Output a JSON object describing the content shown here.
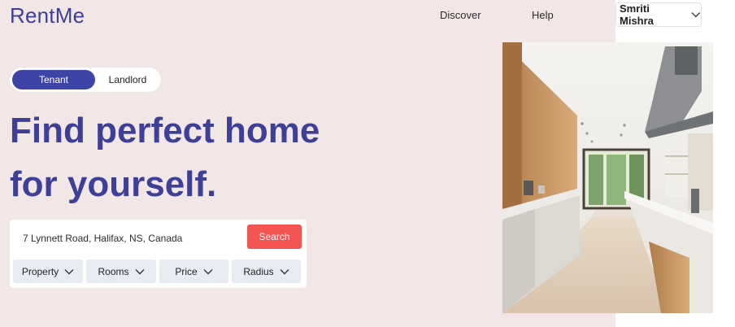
{
  "app": {
    "logo": "RentMe"
  },
  "nav": {
    "discover": "Discover",
    "help": "Help",
    "user_name": "Smriti Mishra"
  },
  "mode_toggle": {
    "options": [
      "Tenant",
      "Landlord"
    ],
    "selected": "Tenant"
  },
  "hero": {
    "headline_line1": "Find perfect home",
    "headline_line2": "for yourself."
  },
  "search": {
    "value": "7 Lynnett Road, Halifax, NS, Canada",
    "button_label": "Search"
  },
  "filters": [
    "Property",
    "Rooms",
    "Price",
    "Radius"
  ],
  "colors": {
    "brand": "#3d3f99",
    "toggle_active": "#3d44a6",
    "search_button": "#f25552",
    "hero_background": "#f3e6e7",
    "filter_background": "#e6ecf2"
  },
  "hero_image": {
    "subject": "modern-kitchen-photo"
  }
}
